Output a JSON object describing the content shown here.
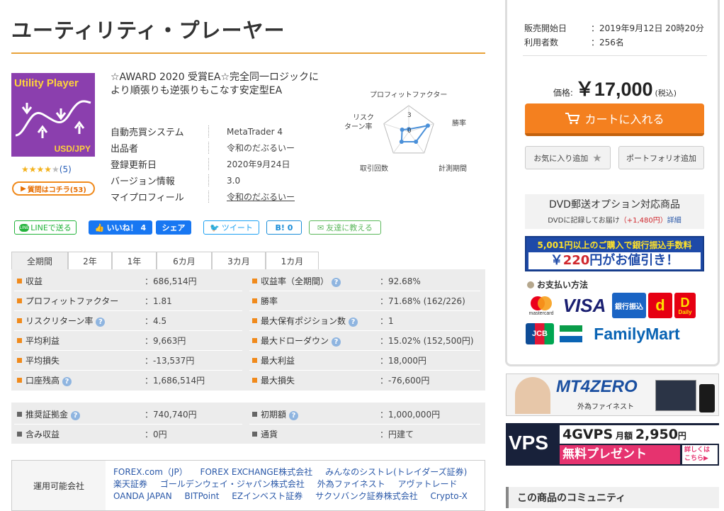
{
  "product": {
    "title": "ユーティリティ・プレーヤー",
    "thumb_title": "Utility Player",
    "thumb_pair": "USD/JPY",
    "rating_stars": "★★★★",
    "rating_star_off": "★",
    "rating_count": "(5)",
    "question_button": "質問はコチラ(53)",
    "description": "☆AWARD 2020 受賞EA☆完全同一ロジックにより順張りも逆張りもこなす安定型EA",
    "info": [
      {
        "label": "自動売買システム",
        "value": "MetaTrader 4"
      },
      {
        "label": "出品者",
        "value": "令和のだぶるいー"
      },
      {
        "label": "登録更新日",
        "value": "2020年9月24日"
      },
      {
        "label": "バージョン情報",
        "value": "3.0"
      },
      {
        "label": "マイプロフィール",
        "value": "令和のだぶるいー"
      }
    ]
  },
  "radar": {
    "labels": [
      "プロフィットファクター",
      "勝率",
      "計測期間",
      "取引回数",
      "リスクリターン率"
    ],
    "label_top": "プロフィットファクター",
    "label_right": "勝率",
    "label_bottom_right": "計測期間",
    "label_bottom_left": "取引回数",
    "label_left_1": "リスク",
    "label_left_2": "ターン率",
    "scale_max": "3",
    "scale_min": "0",
    "values": [
      0.3,
      2.3,
      1.4,
      1.4,
      0.8
    ],
    "max": 3,
    "line_color": "#4a90d9"
  },
  "social": {
    "line": "LINEで送る",
    "like": "いいね！ 4",
    "share": "シェア",
    "tweet": "ツイート",
    "hatena": "B! 0",
    "tell_friend": "友達に教える"
  },
  "tabs": [
    "全期間",
    "2年",
    "1年",
    "6カ月",
    "3カ月",
    "1カ月"
  ],
  "stats": {
    "left": [
      {
        "label": "収益",
        "value": "：686,514円",
        "help": false
      },
      {
        "label": "プロフィットファクター",
        "value": "：1.81",
        "help": false
      },
      {
        "label": "リスクリターン率",
        "value": "：4.5",
        "help": true
      },
      {
        "label": "平均利益",
        "value": "：9,663円",
        "help": false
      },
      {
        "label": "平均損失",
        "value": "：-13,537円",
        "help": false
      },
      {
        "label": "口座残高",
        "value": "：1,686,514円",
        "help": true
      }
    ],
    "right": [
      {
        "label": "収益率（全期間）",
        "value": "：92.68%",
        "help": true
      },
      {
        "label": "勝率",
        "value": "：71.68% (162/226)",
        "help": false
      },
      {
        "label": "最大保有ポジション数",
        "value": "：1",
        "help": true
      },
      {
        "label": "最大ドローダウン",
        "value": "：15.02% (152,500円)",
        "help": true
      },
      {
        "label": "最大利益",
        "value": "：18,000円",
        "help": false
      },
      {
        "label": "最大損失",
        "value": "：-76,600円",
        "help": false
      }
    ],
    "help_mark": "?"
  },
  "stats2": {
    "left": [
      {
        "label": "推奨証拠金",
        "value": "：740,740円",
        "help": true
      },
      {
        "label": "含み収益",
        "value": "：0円",
        "help": false
      }
    ],
    "right": [
      {
        "label": "初期額",
        "value": "：1,000,000円",
        "help": true
      },
      {
        "label": "通貨",
        "value": "：円建て",
        "help": false
      }
    ]
  },
  "brokers": {
    "label": "運用可能会社",
    "list": [
      "FOREX.com（JP）",
      "FOREX EXCHANGE株式会社",
      "みんなのシストレ(トレイダーズ証券)",
      "楽天証券",
      "ゴールデンウェイ・ジャパン株式会社",
      "外為ファイネスト",
      "アヴァトレード",
      "OANDA JAPAN",
      "BITPoint",
      "EZインベスト証券",
      "サクソバンク証券株式会社",
      "Crypto-X"
    ]
  },
  "sidebar": {
    "start_label": "販売開始日",
    "start_value": "：2019年9月12日 20時20分",
    "users_label": "利用者数",
    "users_value": "：256名",
    "price_label": "価格:",
    "price_value": "￥17,000",
    "price_tax": "(税込)",
    "cart_button": "カートに入れる",
    "favorite_button": "お気に入り追加",
    "portfolio_button": "ポートフォリオ追加",
    "dvd_title": "DVD郵送オプション対応商品",
    "dvd_sub": "DVDに記録してお届け",
    "dvd_price": "（+1,480円）",
    "dvd_detail": "詳細",
    "banner_line1": "5,001円以上のご購入で銀行振込手数料",
    "banner_yen": "￥",
    "banner_amount": "220",
    "banner_suffix": "円がお値引き！",
    "pay_title": "お支払い方法",
    "pay_mastercard": "mastercard",
    "pay_visa": "VISA",
    "pay_bank": "銀行振込",
    "pay_jcb": "JCB",
    "pay_familymart": "FamilyMart",
    "pay_daily": "Daily",
    "ad1_title": "MT4ZERO",
    "ad1_sub": "外為ファイネスト",
    "ad2_left": "VPS",
    "ad2_plan": "4GVPS",
    "ad2_monthly": "月額",
    "ad2_price": "2,950",
    "ad2_unit": "円",
    "ad2_free": "無料プレゼント",
    "ad2_more": "詳しくはこちら▶",
    "community_title": "この商品のコミュニティ"
  },
  "colors": {
    "accent_orange": "#f4801f",
    "title_rule": "#e8a33a",
    "link_blue": "#2a58a8",
    "thumb_purple": "#8b3fae"
  }
}
